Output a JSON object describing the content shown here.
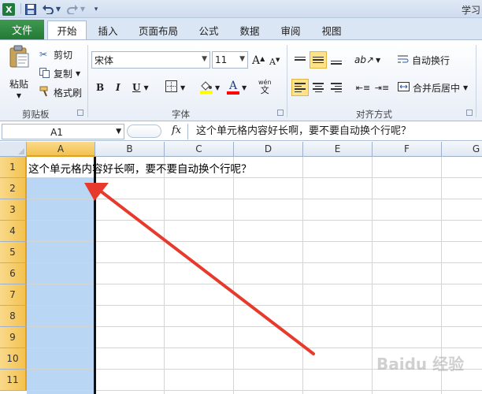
{
  "titlebar": {
    "title": "学习",
    "app_icon": "excel-icon",
    "save_icon": "save-icon",
    "undo_icon": "undo-icon",
    "redo_icon": "redo-icon",
    "customize_icon": "customize-quick-access-icon"
  },
  "tabs": {
    "file": "文件",
    "home": "开始",
    "insert": "插入",
    "page_layout": "页面布局",
    "formulas": "公式",
    "data": "数据",
    "review": "审阅",
    "view": "视图"
  },
  "ribbon": {
    "clipboard": {
      "paste": "粘贴",
      "cut": "剪切",
      "copy": "复制",
      "format_painter": "格式刷",
      "group_label": "剪贴板"
    },
    "font": {
      "font_name": "宋体",
      "font_size": "11",
      "grow_label": "A",
      "shrink_label": "A",
      "bold": "B",
      "italic": "I",
      "underline": "U",
      "font_color_label": "A",
      "phonetic_label": "wén",
      "group_label": "字体",
      "fill_color": "#ffff00",
      "text_color": "#ff0000"
    },
    "alignment": {
      "wrap_text": "自动换行",
      "merge_center": "合并后居中",
      "group_label": "对齐方式"
    }
  },
  "formula_bar": {
    "name_box": "A1",
    "fx_label": "fx",
    "content": "这个单元格内容好长啊，要不要自动换个行呢？"
  },
  "sheet": {
    "columns": [
      "A",
      "B",
      "C",
      "D",
      "E",
      "F",
      "G"
    ],
    "rows": [
      "1",
      "2",
      "3",
      "4",
      "5",
      "6",
      "7",
      "8",
      "9",
      "10",
      "11"
    ],
    "selected_column": "A",
    "cell_a1": "这个单元格内容好长啊，要不要自动换个行呢？",
    "selection_color": "#b9d7f4",
    "header_highlight_color": "#f3c24f",
    "arrow_color": "#e83a2c"
  },
  "watermark": "Baidu 经验"
}
